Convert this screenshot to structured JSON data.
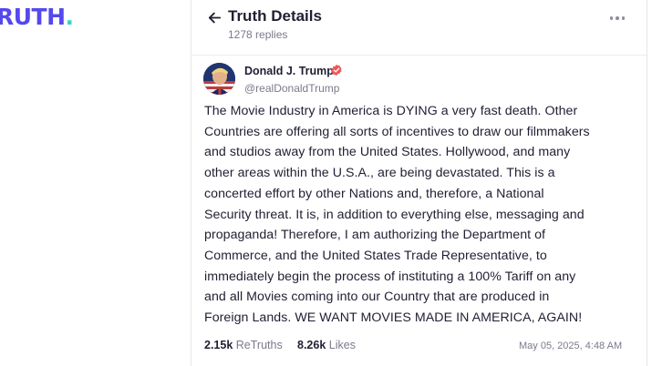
{
  "brand": {
    "logo_text": "RUTH",
    "logo_dot": "."
  },
  "header": {
    "title": "Truth Details",
    "replies_label": "1278 replies"
  },
  "post": {
    "author_name": "Donald J. Trump",
    "author_handle": "@realDonaldTrump",
    "verified": true,
    "text": "The Movie Industry in America is DYING a very fast death. Other\nCountries are offering all sorts of incentives to draw our filmmakers\nand studios away from the United States. Hollywood, and many\nother areas within the U.S.A., are being devastated. This is a\nconcerted effort by other Nations and, therefore, a National\nSecurity threat. It is, in addition to everything else, messaging and\npropaganda! Therefore, I am authorizing the Department of\nCommerce, and the United States Trade Representative, to\nimmediately begin the process of instituting a 100% Tariff on any\nand all Movies coming into our Country that are produced in\nForeign Lands. WE WANT MOVIES MADE IN AMERICA, AGAIN!",
    "retruths_count": "2.15k",
    "retruths_label": "ReTruths",
    "likes_count": "8.26k",
    "likes_label": "Likes",
    "timestamp": "May 05, 2025, 4:48 AM"
  },
  "colors": {
    "brand": "#5448ee",
    "brand_dot": "#34d3c4",
    "text": "#1f1f33",
    "muted": "#7a7a8c",
    "verified_badge": "#ee5a5a"
  },
  "icons": {
    "back": "arrow-left-icon",
    "more": "more-horizontal-icon",
    "verified": "verified-badge-icon"
  }
}
